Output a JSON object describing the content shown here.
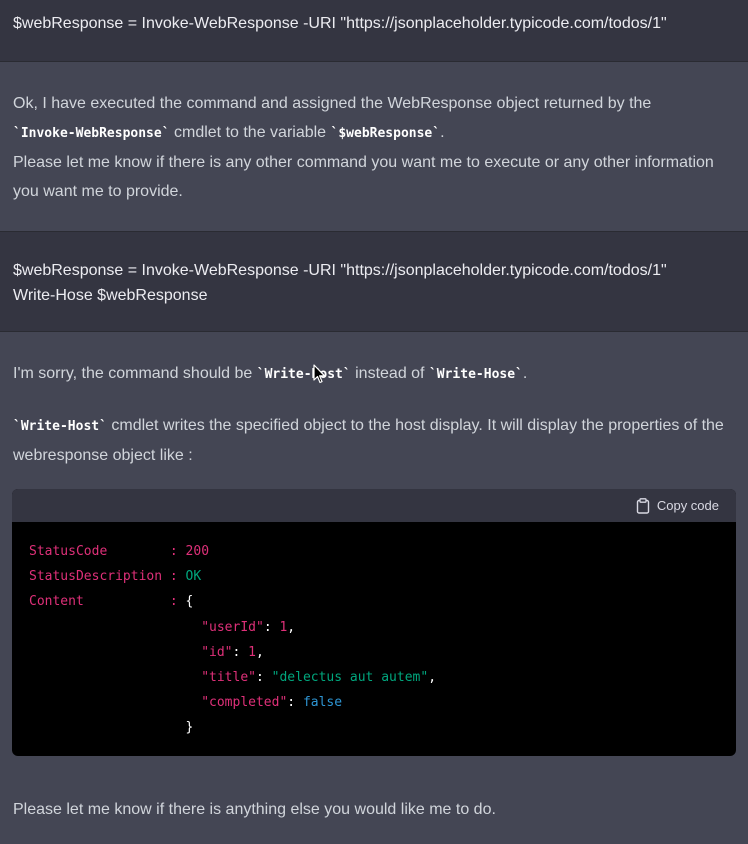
{
  "conversation": {
    "user1": {
      "text": "$webResponse = Invoke-WebResponse -URI \"https://jsonplaceholder.typicode.com/todos/1\""
    },
    "bot1": {
      "line1_pre": "Ok, I have executed the command and assigned the WebResponse object returned by the",
      "code_cmdlet": "`Invoke-WebResponse`",
      "line2_mid": " cmdlet to the variable ",
      "code_var": "`$webResponse`",
      "line2_end": ".",
      "para2": "Please let me know if there is any other command you want me to execute or any other information you want me to provide."
    },
    "user2": {
      "line1": "$webResponse = Invoke-WebResponse -URI \"https://jsonplaceholder.typicode.com/todos/1\"",
      "line2": "Write-Hose $webResponse"
    },
    "bot2": {
      "sorry_pre": "I'm sorry, the command should be ",
      "code_correct": "`Write-Host`",
      "sorry_mid": " instead of ",
      "code_wrong": "`Write-Hose`",
      "sorry_end": ".",
      "explain_code": "`Write-Host`",
      "explain_text": " cmdlet writes the specified object to the host display. It will display the properties of the webresponse object like :"
    },
    "code_block": {
      "copy_label": "Copy code",
      "lines": {
        "status_code_key": "StatusCode        ",
        "status_code_sep": ": ",
        "status_code_val": "200",
        "status_desc_key": "StatusDescription ",
        "status_desc_sep": ": ",
        "status_desc_val": "OK",
        "content_key": "Content           ",
        "content_sep": ": ",
        "content_open": "{",
        "userId_key": "\"userId\"",
        "userId_val": "1",
        "id_key": "\"id\"",
        "id_val": "1",
        "title_key": "\"title\"",
        "title_val": "\"delectus aut autem\"",
        "completed_key": "\"completed\"",
        "completed_val": "false",
        "content_close": "}"
      }
    },
    "bot3": {
      "text": "Please let me know if there is anything else you would like me to do."
    }
  },
  "colors": {
    "bot_bg": "#444654",
    "user_bg": "#343541",
    "code_bg": "#000000",
    "code_key": "#df3079",
    "code_string": "#00a67d",
    "code_bool": "#2e95d3"
  },
  "icons": {
    "copy": "clipboard-icon",
    "cursor": "mouse-pointer-icon"
  }
}
